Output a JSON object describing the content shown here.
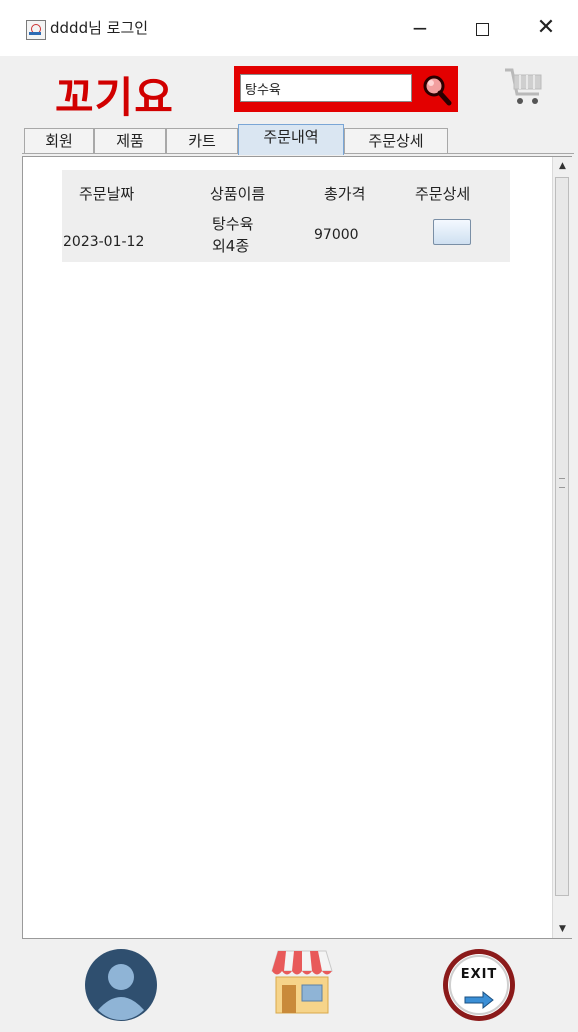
{
  "window": {
    "title": "dddd님 로그인",
    "controls": {
      "minimize": "−",
      "close": "✕"
    }
  },
  "header": {
    "logo_text": "꼬기요",
    "search": {
      "value": "탕수육",
      "icon": "magnifier-icon"
    },
    "cart_icon": "cart-icon"
  },
  "tabs": [
    {
      "label": "회원"
    },
    {
      "label": "제품"
    },
    {
      "label": "카트"
    },
    {
      "label": "주문내역",
      "active": true
    },
    {
      "label": "주문상세"
    }
  ],
  "order_table": {
    "columns": [
      "주문날짜",
      "상품이름",
      "총가격",
      "주문상세"
    ],
    "rows": [
      {
        "date": "2023-01-12",
        "product_line1": "탕수육",
        "product_line2": "외4종",
        "total": "97000"
      }
    ]
  },
  "scrollbar": {
    "up": "▲",
    "down": "▼"
  },
  "bottom_nav": {
    "profile_icon": "user-icon",
    "store_icon": "store-icon",
    "exit_label": "EXIT"
  },
  "colors": {
    "brand_red": "#d10000",
    "search_red": "#e30000",
    "active_tab": "#dae6f2",
    "profile_blue": "#2f4f6f"
  }
}
